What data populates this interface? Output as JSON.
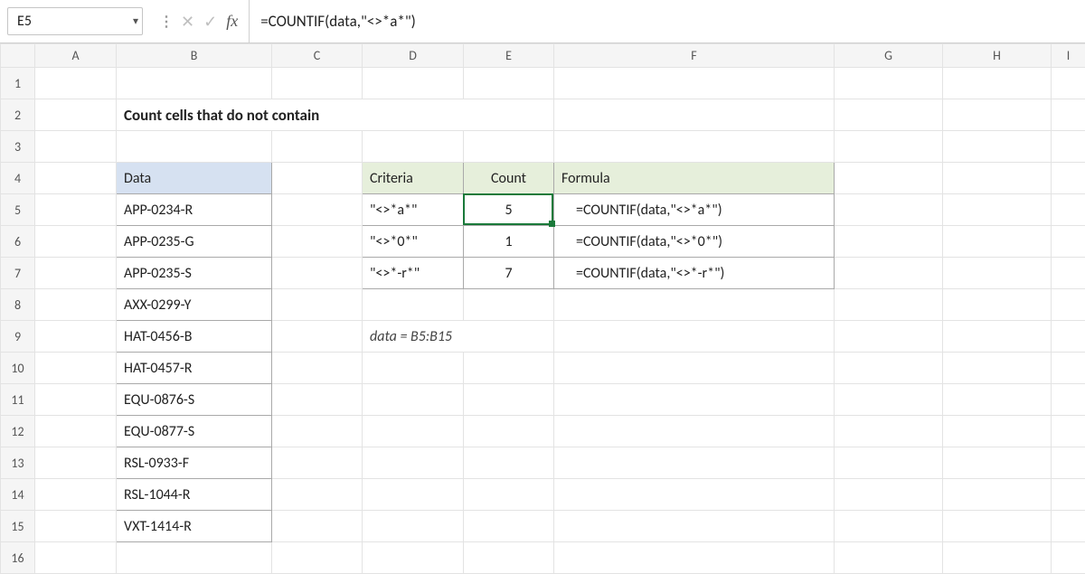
{
  "name_box": {
    "value": "E5"
  },
  "formula_bar": {
    "value": "=COUNTIF(data,\"<>*a*\")"
  },
  "columns": [
    "A",
    "B",
    "C",
    "D",
    "E",
    "F",
    "G",
    "H",
    "I"
  ],
  "rows": [
    1,
    2,
    3,
    4,
    5,
    6,
    7,
    8,
    9,
    10,
    11,
    12,
    13,
    14,
    15,
    16
  ],
  "title": "Count cells that do not contain",
  "data_header": "Data",
  "data_values": [
    "APP-0234-R",
    "APP-0235-G",
    "APP-0235-S",
    "AXX-0299-Y",
    "HAT-0456-B",
    "HAT-0457-R",
    "EQU-0876-S",
    "EQU-0877-S",
    "RSL-0933-F",
    "RSL-1044-R",
    "VXT-1414-R"
  ],
  "result_headers": {
    "criteria": "Criteria",
    "count": "Count",
    "formula": "Formula"
  },
  "results": [
    {
      "criteria": "\"<>*a*\"",
      "count": 5,
      "formula": "=COUNTIF(data,\"<>*a*\")"
    },
    {
      "criteria": "\"<>*0*\"",
      "count": 1,
      "formula": "=COUNTIF(data,\"<>*0*\")"
    },
    {
      "criteria": "\"<>*-r*\"",
      "count": 7,
      "formula": "=COUNTIF(data,\"<>*-r*\")"
    }
  ],
  "range_note": "data = B5:B15",
  "colors": {
    "blue_header": "#d6e1f1",
    "green_header": "#e6efdb",
    "selection": "#1a7a3a"
  }
}
